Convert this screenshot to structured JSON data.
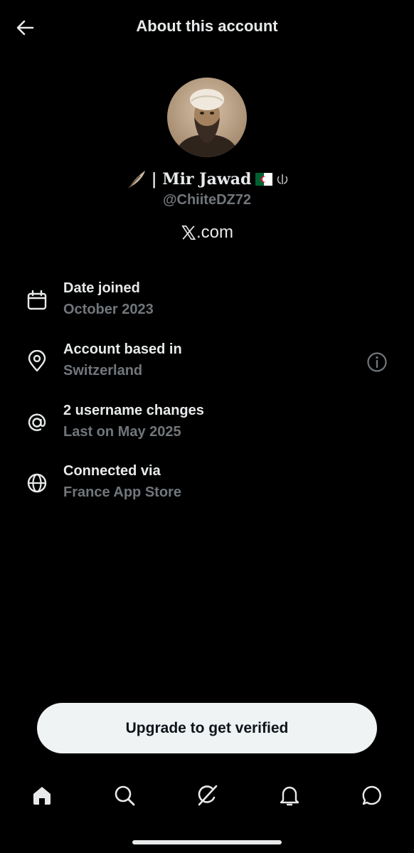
{
  "header": {
    "title": "About this account"
  },
  "profile": {
    "name": "| Mir Jawad",
    "handle": "@ChiiteDZ72",
    "site": ".com",
    "site_logo": "X"
  },
  "details": [
    {
      "icon": "calendar-icon",
      "label": "Date joined",
      "value": "October 2023"
    },
    {
      "icon": "location-pin-icon",
      "label": "Account based in",
      "value": "Switzerland",
      "has_info": true
    },
    {
      "icon": "at-sign-icon",
      "label": "2 username changes",
      "value": "Last on May 2025"
    },
    {
      "icon": "globe-icon",
      "label": "Connected via",
      "value": "France App Store"
    }
  ],
  "cta": {
    "label": "Upgrade to get verified"
  },
  "tabs": [
    {
      "name": "home",
      "icon": "home-icon",
      "active": true
    },
    {
      "name": "search",
      "icon": "search-icon"
    },
    {
      "name": "grok",
      "icon": "grok-icon"
    },
    {
      "name": "notifications",
      "icon": "bell-icon"
    },
    {
      "name": "messages",
      "icon": "chat-icon"
    }
  ],
  "colors": {
    "background": "#000000",
    "primary_text": "#e7e9ea",
    "secondary_text": "#71767b",
    "button_bg": "#eff3f4"
  }
}
